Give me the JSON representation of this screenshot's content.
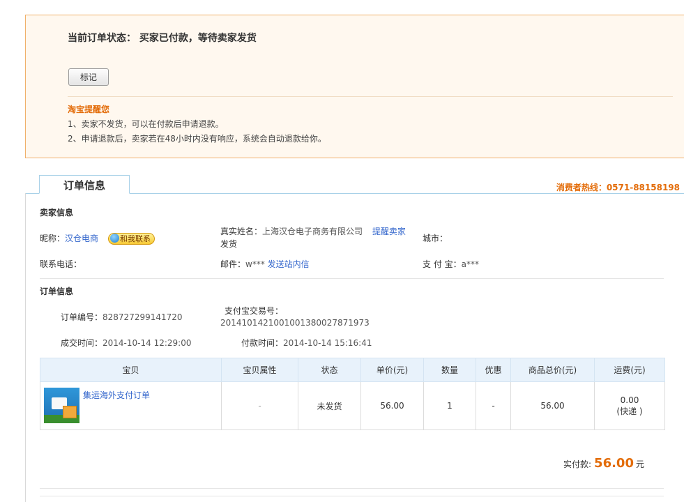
{
  "status": {
    "title": "当前订单状态： 买家已付款，等待卖家发货",
    "mark_button": "标记",
    "reminder_title": "淘宝提醒您",
    "reminders": [
      "1、卖家不发货，可以在付款后申请退款。",
      "2、申请退款后，卖家若在48小时内没有响应，系统会自动退款给你。"
    ]
  },
  "tab": {
    "label": "订单信息"
  },
  "hotline": "消费者热线：0571-88158198",
  "seller": {
    "section_title": "卖家信息",
    "nickname_label": "昵称：",
    "nickname": "汉仓电商",
    "contact_badge": "和我联系",
    "realname_label": "真实姓名：",
    "realname": "上海汉仓电子商务有限公司",
    "remind_link_1": "提醒卖家",
    "remind_link_2": "发货",
    "city_label": "城市：",
    "city": "",
    "phone_label": "联系电话：",
    "phone": "",
    "email_label": "邮件：",
    "email": "w***",
    "message_link": "发送站内信",
    "alipay_label": "支 付 宝：",
    "alipay": "a***"
  },
  "order": {
    "section_title": "订单信息",
    "order_no_label": "订单编号：",
    "order_no": "828727299141720",
    "alipay_trade_label": "支付宝交易号：",
    "alipay_trade_no": "2014101421001001380027871973",
    "deal_time_label": "成交时间：",
    "deal_time": "2014-10-14 12:29:00",
    "pay_time_label": "付款时间：",
    "pay_time": "2014-10-14 15:16:41"
  },
  "table": {
    "headers": [
      "宝贝",
      "宝贝属性",
      "状态",
      "单价(元)",
      "数量",
      "优惠",
      "商品总价(元)",
      "运费(元)"
    ],
    "row": {
      "name": "集运海外支付订单",
      "attrs": "-",
      "status": "未发货",
      "price": "56.00",
      "qty": "1",
      "discount": "-",
      "total": "56.00",
      "shipping": "0.00",
      "shipping_method": "(快递 )"
    }
  },
  "payment": {
    "label": "实付款:",
    "amount": "56.00",
    "unit": "元"
  },
  "colors": {
    "accent_orange": "#e36c09",
    "link_blue": "#3366cc",
    "panel_bg": "#fff8ef",
    "panel_border": "#f0b06a",
    "table_header_bg": "#e8f2fb"
  }
}
